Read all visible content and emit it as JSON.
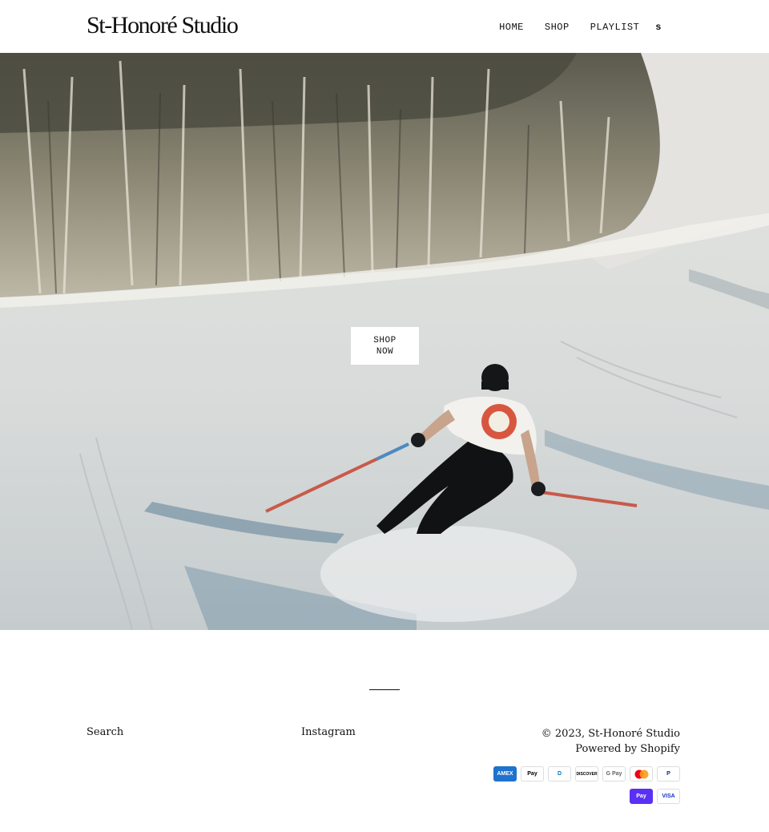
{
  "header": {
    "logo": "St-Honoré Studio",
    "nav": [
      {
        "label": "HOME"
      },
      {
        "label": "SHOP"
      },
      {
        "label": "PLAYLIST"
      },
      {
        "label": "s"
      }
    ]
  },
  "hero": {
    "cta_line1": "SHOP",
    "cta_line2": "NOW",
    "image_alt": "skier-on-snowy-slope"
  },
  "footer": {
    "search_label": "Search",
    "instagram_label": "Instagram",
    "copyright": "© 2023, St-Honoré Studio",
    "powered": "Powered by Shopify",
    "payments": [
      {
        "name": "American Express",
        "label": "AMEX",
        "icon": "amex-icon",
        "bg": "#1f72cd",
        "fg": "#ffffff"
      },
      {
        "name": "Apple Pay",
        "label": "Pay",
        "icon": "apple-pay-icon",
        "bg": "#ffffff",
        "fg": "#000000"
      },
      {
        "name": "Diners Club",
        "label": "D",
        "icon": "diners-club-icon",
        "bg": "#ffffff",
        "fg": "#0079be"
      },
      {
        "name": "Discover",
        "label": "DISCOVER",
        "icon": "discover-icon",
        "bg": "#ffffff",
        "fg": "#000000"
      },
      {
        "name": "Google Pay",
        "label": "G Pay",
        "icon": "google-pay-icon",
        "bg": "#ffffff",
        "fg": "#5f6368"
      },
      {
        "name": "Mastercard",
        "label": "",
        "icon": "mastercard-icon",
        "bg": "#ffffff",
        "fg": "#000000"
      },
      {
        "name": "PayPal",
        "label": "P",
        "icon": "paypal-icon",
        "bg": "#ffffff",
        "fg": "#003087"
      },
      {
        "name": "Shop Pay",
        "label": "Pay",
        "icon": "shop-pay-icon",
        "bg": "#5a31f4",
        "fg": "#ffffff"
      },
      {
        "name": "Visa",
        "label": "VISA",
        "icon": "visa-icon",
        "bg": "#ffffff",
        "fg": "#1434cb"
      }
    ]
  }
}
